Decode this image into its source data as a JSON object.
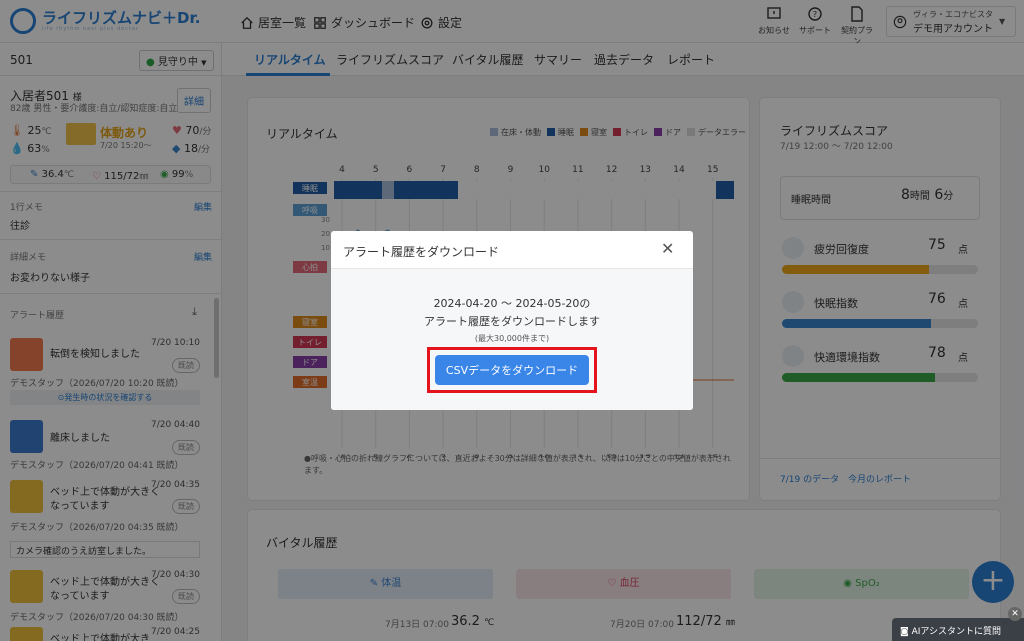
{
  "header": {
    "logo_text": "ライフリズムナビ＋Dr.",
    "logo_sub": "life rhythm navi plus doctor",
    "nav": [
      {
        "label": "居室一覧",
        "icon": "home-icon"
      },
      {
        "label": "ダッシュボード",
        "icon": "grid-icon"
      },
      {
        "label": "設定",
        "icon": "gear-icon"
      }
    ],
    "icons": [
      {
        "label": "お知らせ",
        "icon": "notice-icon"
      },
      {
        "label": "サポート",
        "icon": "help-icon"
      },
      {
        "label": "契約プラン",
        "icon": "plan-icon"
      }
    ],
    "account": {
      "line1": "ヴィラ・エコナビスタ",
      "line2": "デモ用アカウント"
    }
  },
  "sidebar": {
    "room": "501",
    "watch_status": "見守り中",
    "resident_name": "入居者501",
    "resident_honorific": "様",
    "resident_info": "82歳 男性・要介護度:自立/認知症度:自立",
    "detail_button": "詳細",
    "temp": "25",
    "temp_unit": "℃",
    "humidity": "63",
    "humidity_unit": "%",
    "status_label": "体動あり",
    "status_time": "7/20 15:20〜",
    "heart_rate": "70",
    "heart_unit": "/分",
    "resp_rate": "18",
    "resp_unit": "/分",
    "body_temp": "36.4",
    "body_temp_unit": "℃",
    "bp": "115/72",
    "bp_unit": "㎜",
    "spo2": "99",
    "spo2_unit": "%",
    "memo1_label": "1行メモ",
    "memo1_edit": "編集",
    "memo1_text": "往診",
    "memo2_label": "詳細メモ",
    "memo2_edit": "編集",
    "memo2_text": "お変わりない様子",
    "alert_history_label": "アラート履歴",
    "alerts": [
      {
        "title": "転倒を検知しました",
        "time": "7/20 10:10",
        "by": "デモスタッフ（2026/07/20 10:20 既読）",
        "read": "既読",
        "link": "⊙発生時の状況を確認する"
      },
      {
        "title": "離床しました",
        "time": "7/20 04:40",
        "by": "デモスタッフ（2026/07/20 04:41 既読）",
        "read": "既読"
      },
      {
        "title": "ベッド上で体動が大きくなっています",
        "time": "7/20 04:35",
        "by": "デモスタッフ（2026/07/20 04:35 既読）",
        "read": "既読",
        "note": "カメラ確認のうえ訪室しました。"
      },
      {
        "title": "ベッド上で体動が大きくなっています",
        "time": "7/20 04:30",
        "by": "デモスタッフ（2026/07/20 04:30 既読）",
        "read": "既読"
      },
      {
        "title": "ベッド上で体動が大き",
        "time": "7/20 04:25",
        "by": "",
        "read": ""
      }
    ]
  },
  "tabs": [
    "リアルタイム",
    "ライフリズムスコア",
    "バイタル履歴",
    "サマリー",
    "過去データ",
    "レポート"
  ],
  "realtime": {
    "title": "リアルタイム",
    "legend": [
      {
        "label": "在床・体動",
        "color": "#a9c0dc"
      },
      {
        "label": "睡眠",
        "color": "#1f5ea8"
      },
      {
        "label": "寝室",
        "color": "#e08a1e"
      },
      {
        "label": "トイレ",
        "color": "#d13a55"
      },
      {
        "label": "ドア",
        "color": "#8a3ea8"
      },
      {
        "label": "データエラー",
        "color": "#dcdcdc"
      }
    ],
    "hours": [
      "4",
      "5",
      "6",
      "7",
      "8",
      "9",
      "10",
      "11",
      "12",
      "13",
      "14",
      "15"
    ],
    "rows": [
      {
        "label": "睡眠",
        "color": "#1f5ea8"
      },
      {
        "label": "呼吸",
        "color": "#5ba0d8"
      },
      {
        "label": "心拍",
        "color": "#e56a7a"
      },
      {
        "label": "寝室",
        "color": "#e08a1e"
      },
      {
        "label": "トイレ",
        "color": "#d13a55"
      },
      {
        "label": "ドア",
        "color": "#8a3ea8"
      },
      {
        "label": "室温",
        "color": "#e06d2a"
      }
    ],
    "y_ticks": [
      "30",
      "20",
      "10"
    ],
    "note": "●呼吸・心拍の折れ線グラフについては、直近およそ30分は詳細な値が表示され、以降は10分ごとの中央値が表示されます。"
  },
  "score": {
    "title": "ライフリズムスコア",
    "range": "7/19 12:00 〜 7/20 12:00",
    "sleep_label": "睡眠時間",
    "sleep_hours": "8",
    "sleep_hours_unit": "時間",
    "sleep_min": "6",
    "sleep_min_unit": "分",
    "items": [
      {
        "label": "疲労回復度",
        "value": "75",
        "unit": "点",
        "fill": 0.75,
        "color": "#f0a81a",
        "icon": "fatigue-icon"
      },
      {
        "label": "快眠指数",
        "value": "76",
        "unit": "点",
        "fill": 0.76,
        "color": "#3b86d0",
        "icon": "sleep-icon"
      },
      {
        "label": "快適環境指数",
        "value": "78",
        "unit": "点",
        "fill": 0.78,
        "color": "#3aa84a",
        "icon": "thermometer-icon"
      }
    ],
    "link1": "7/19 のデータ",
    "link2": "今月のレポート"
  },
  "vitals": {
    "title": "バイタル履歴",
    "cards": [
      {
        "label": "体温",
        "date": "7月13日 07:00",
        "value": "36.2",
        "unit": "℃",
        "icon": "pen-icon"
      },
      {
        "label": "血圧",
        "date": "7月20日 07:00",
        "value": "112/72",
        "unit": "㎜",
        "icon": "heart-icon"
      },
      {
        "label": "SpO₂",
        "date": "",
        "value": "",
        "unit": "",
        "icon": "drop-icon"
      }
    ]
  },
  "modal": {
    "title": "アラート履歴をダウンロード",
    "range_text": "2024-04-20 〜 2024-05-20の",
    "desc": "アラート履歴をダウンロードします",
    "limit": "(最大30,000件まで)",
    "button": "CSVデータをダウンロード"
  },
  "fab": "+",
  "ai_button": "AIアシスタントに質問"
}
